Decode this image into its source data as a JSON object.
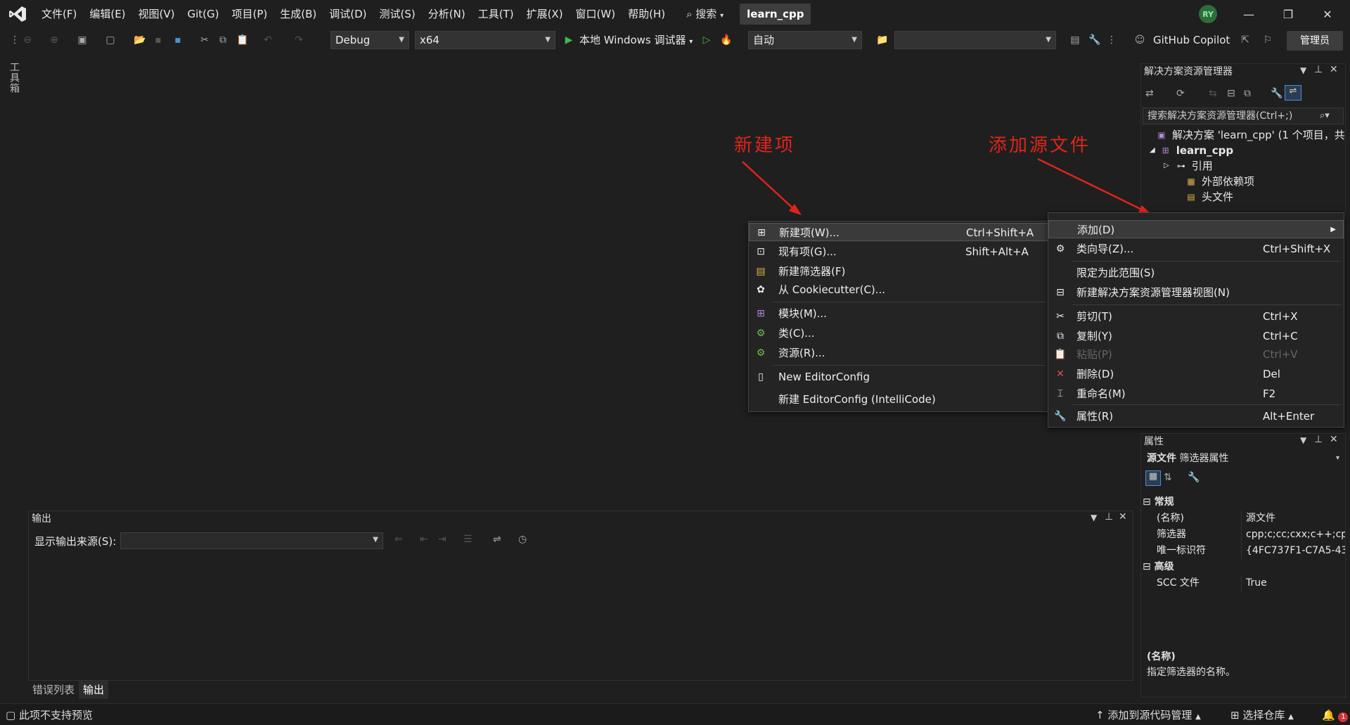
{
  "menubar": {
    "items": [
      "文件(F)",
      "编辑(E)",
      "视图(V)",
      "Git(G)",
      "项目(P)",
      "生成(B)",
      "调试(D)",
      "测试(S)",
      "分析(N)",
      "工具(T)",
      "扩展(X)",
      "窗口(W)",
      "帮助(H)"
    ],
    "search_label": "搜索",
    "solution_name": "learn_cpp",
    "avatar_initials": "RY"
  },
  "toolbar": {
    "config": "Debug",
    "platform": "x64",
    "debugger_label": "本地 Windows 调试器",
    "auto_label": "自动",
    "github_copilot": "GitHub Copilot",
    "admin_label": "管理员"
  },
  "toolbox_tab": "工具箱",
  "solution_explorer": {
    "title": "解决方案资源管理器",
    "search_placeholder": "搜索解决方案资源管理器(Ctrl+;)",
    "tree": {
      "solution": "解决方案 'learn_cpp' (1 个项目，共",
      "project": "learn_cpp",
      "references": "引用",
      "external_deps": "外部依赖项",
      "headers": "头文件"
    }
  },
  "annotations": {
    "new_item": "新建项",
    "add_source": "添加源文件"
  },
  "submenu": {
    "items": [
      {
        "label": "新建项(W)...",
        "shortcut": "Ctrl+Shift+A"
      },
      {
        "label": "现有项(G)...",
        "shortcut": "Shift+Alt+A"
      },
      {
        "label": "新建筛选器(F)",
        "shortcut": ""
      },
      {
        "label": "从 Cookiecutter(C)...",
        "shortcut": ""
      },
      {
        "label": "模块(M)...",
        "shortcut": ""
      },
      {
        "label": "类(C)...",
        "shortcut": ""
      },
      {
        "label": "资源(R)...",
        "shortcut": ""
      },
      {
        "label": "New EditorConfig",
        "shortcut": ""
      },
      {
        "label": "新建 EditorConfig (IntelliCode)",
        "shortcut": ""
      }
    ]
  },
  "context_menu": {
    "items": [
      {
        "label": "添加(D)",
        "shortcut": ""
      },
      {
        "label": "类向导(Z)...",
        "shortcut": "Ctrl+Shift+X"
      },
      {
        "label": "限定为此范围(S)",
        "shortcut": ""
      },
      {
        "label": "新建解决方案资源管理器视图(N)",
        "shortcut": ""
      },
      {
        "label": "剪切(T)",
        "shortcut": "Ctrl+X"
      },
      {
        "label": "复制(Y)",
        "shortcut": "Ctrl+C"
      },
      {
        "label": "粘贴(P)",
        "shortcut": "Ctrl+V"
      },
      {
        "label": "删除(D)",
        "shortcut": "Del"
      },
      {
        "label": "重命名(M)",
        "shortcut": "F2"
      },
      {
        "label": "属性(R)",
        "shortcut": "Alt+Enter"
      }
    ]
  },
  "output": {
    "title": "输出",
    "source_label": "显示输出来源(S):",
    "tabs": [
      "错误列表",
      "输出"
    ]
  },
  "properties": {
    "title": "属性",
    "object_name": "源文件",
    "object_type": "筛选器属性",
    "cat_general": "常规",
    "rows": [
      {
        "key": "(名称)",
        "value": "源文件"
      },
      {
        "key": "筛选器",
        "value": "cpp;c;cc;cxx;c++;cp"
      },
      {
        "key": "唯一标识符",
        "value": "{4FC737F1-C7A5-43"
      }
    ],
    "cat_advanced": "高级",
    "adv_rows": [
      {
        "key": "SCC 文件",
        "value": "True"
      }
    ],
    "desc_title": "(名称)",
    "desc_text": "指定筛选器的名称。"
  },
  "statusbar": {
    "left": "此项不支持预览",
    "add_source_control": "添加到源代码管理",
    "select_repo": "选择仓库",
    "notification_count": "1"
  },
  "colors": {
    "background": "#1f1f1f",
    "annotation_red": "#e0241b",
    "play_green": "#3fb950"
  }
}
